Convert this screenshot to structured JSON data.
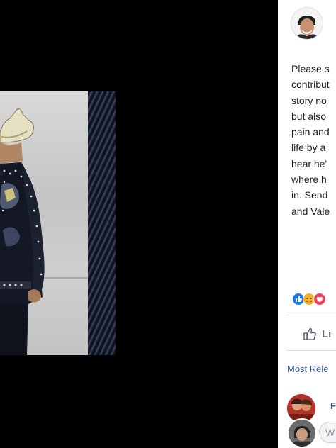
{
  "post": {
    "text_lines": [
      "Please s",
      "contribut",
      "story no",
      "but also",
      "pain and",
      "life by a",
      "hear he'",
      "where h",
      "in. Send",
      "and Vale"
    ]
  },
  "reactions": {
    "icons": [
      "like-icon",
      "sad-icon",
      "love-icon"
    ]
  },
  "actions": {
    "like_label": "Li"
  },
  "comments": {
    "sort_label": "Most Rele",
    "first_commenter": "F",
    "composer_placeholder": "W"
  },
  "colors": {
    "viewer_background": "#000000",
    "link": "#385898",
    "like_blue": "#1877f2",
    "love_red": "#f33e58",
    "sad_yellow": "#f7b125"
  }
}
